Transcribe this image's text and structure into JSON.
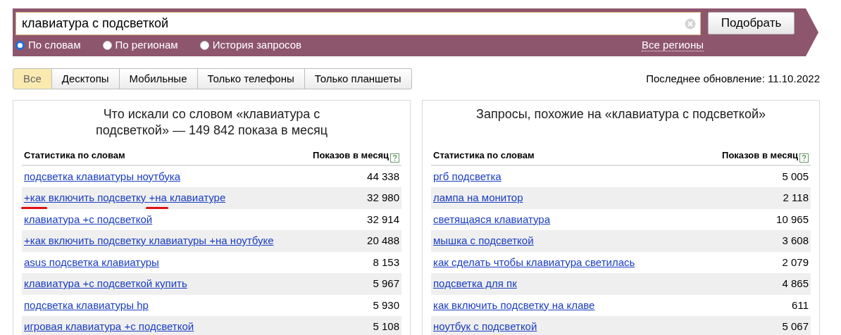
{
  "search": {
    "value": "клавиатура с подсветкой",
    "button": "Подобрать",
    "modes": [
      {
        "label": "По словам",
        "selected": true
      },
      {
        "label": "По регионам",
        "selected": false
      },
      {
        "label": "История запросов",
        "selected": false
      }
    ],
    "region_link": "Все регионы"
  },
  "device_tabs": [
    {
      "label": "Все",
      "selected": true
    },
    {
      "label": "Десктопы",
      "selected": false
    },
    {
      "label": "Мобильные",
      "selected": false
    },
    {
      "label": "Только телефоны",
      "selected": false
    },
    {
      "label": "Только планшеты",
      "selected": false
    }
  ],
  "last_update": "Последнее обновление: 11.10.2022",
  "panels": [
    {
      "title": "Что искали со словом «клавиатура с подсветкой» — 149 842 показа в месяц",
      "columns": [
        "Статистика по словам",
        "Показов в месяц"
      ],
      "rows": [
        {
          "segments": [
            {
              "text": "подсветка клавиатуры ноутбука",
              "marked": false
            }
          ],
          "count": "44 338"
        },
        {
          "segments": [
            {
              "text": "+как",
              "marked": true
            },
            {
              "text": " включить подсветку ",
              "marked": false
            },
            {
              "text": "+на",
              "marked": true
            },
            {
              "text": " клавиатуре",
              "marked": false
            }
          ],
          "count": "32 980"
        },
        {
          "segments": [
            {
              "text": "клавиатура +с подсветкой",
              "marked": false
            }
          ],
          "count": "32 914"
        },
        {
          "segments": [
            {
              "text": "+как включить подсветку клавиатуры +на ноутбуке",
              "marked": false
            }
          ],
          "count": "20 488"
        },
        {
          "segments": [
            {
              "text": "asus подсветка клавиатуры",
              "marked": false
            }
          ],
          "count": "8 153"
        },
        {
          "segments": [
            {
              "text": "клавиатура +с подсветкой купить",
              "marked": false
            }
          ],
          "count": "5 967"
        },
        {
          "segments": [
            {
              "text": "подсветка клавиатуры hp",
              "marked": false
            }
          ],
          "count": "5 930"
        },
        {
          "segments": [
            {
              "text": "игровая клавиатура +с подсветкой",
              "marked": false
            }
          ],
          "count": "5 108"
        }
      ]
    },
    {
      "title": "Запросы, похожие на «клавиатура с подсветкой»",
      "columns": [
        "Статистика по словам",
        "Показов в месяц"
      ],
      "rows": [
        {
          "segments": [
            {
              "text": "ргб подсветка",
              "marked": false
            }
          ],
          "count": "5 005"
        },
        {
          "segments": [
            {
              "text": "лампа на монитор",
              "marked": false
            }
          ],
          "count": "2 118"
        },
        {
          "segments": [
            {
              "text": "светящаяся клавиатура",
              "marked": false
            }
          ],
          "count": "10 965"
        },
        {
          "segments": [
            {
              "text": "мышка с подсветкой",
              "marked": false
            }
          ],
          "count": "3 608"
        },
        {
          "segments": [
            {
              "text": "как сделать чтобы клавиатура светилась",
              "marked": false
            }
          ],
          "count": "2 079"
        },
        {
          "segments": [
            {
              "text": "подсветка для пк",
              "marked": false
            }
          ],
          "count": "4 865"
        },
        {
          "segments": [
            {
              "text": "как включить подсветку на клаве",
              "marked": false
            }
          ],
          "count": "611"
        },
        {
          "segments": [
            {
              "text": "ноутбук с подсветкой",
              "marked": false
            }
          ],
          "count": "5 067"
        }
      ]
    }
  ]
}
